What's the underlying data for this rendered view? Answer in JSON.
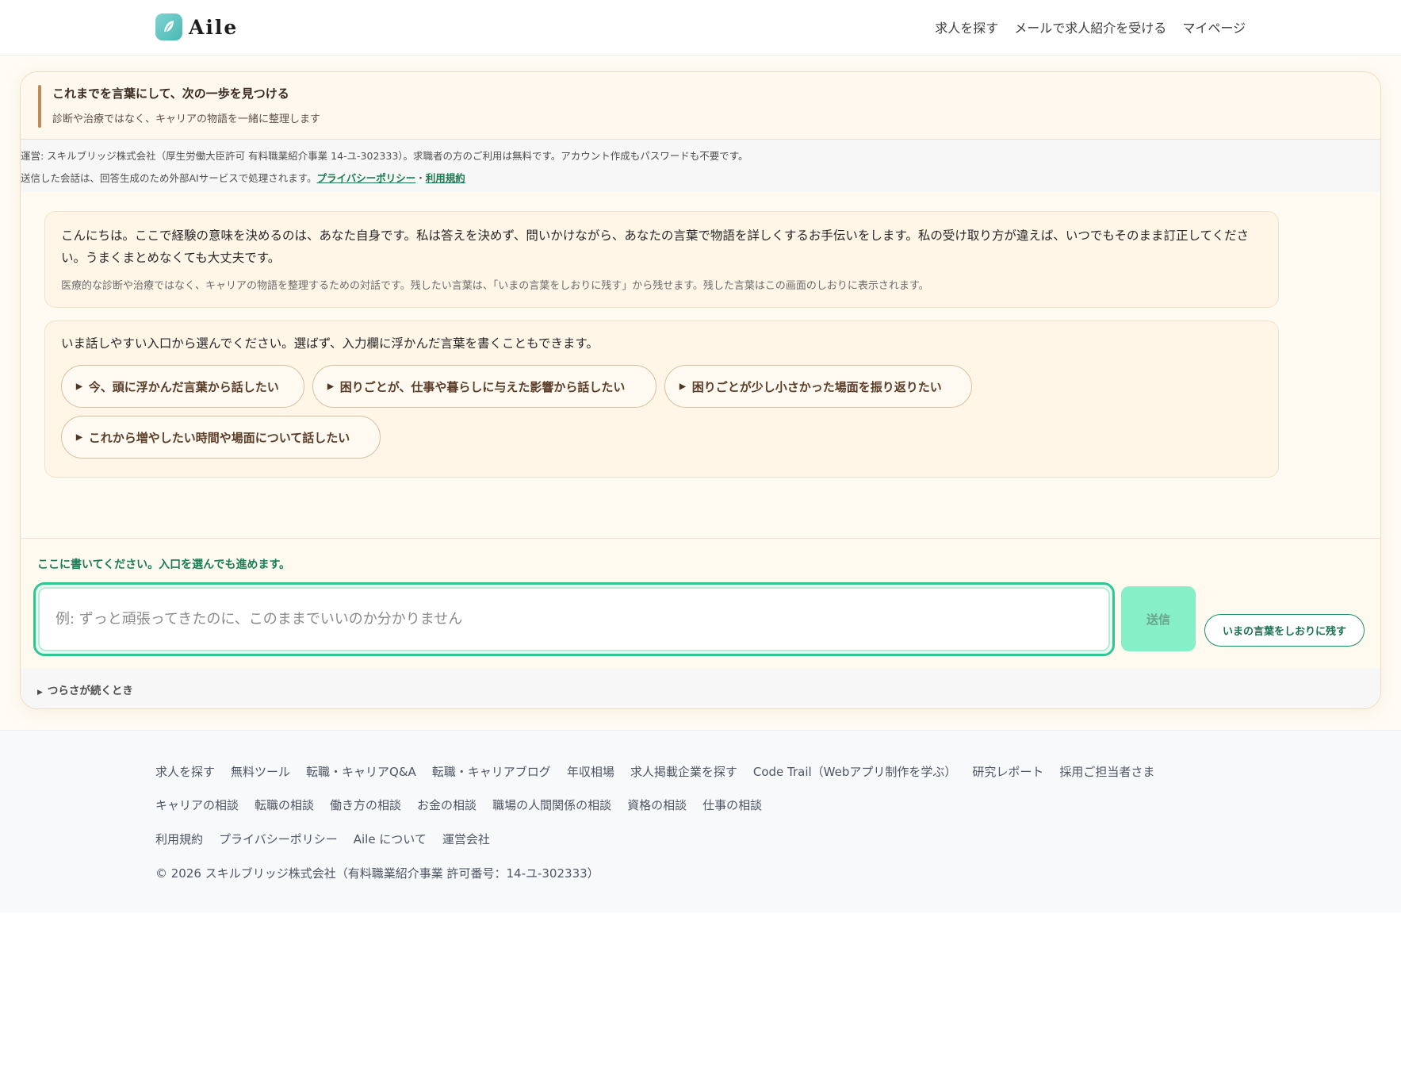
{
  "header": {
    "logo_text": "Aile",
    "nav": [
      "求人を探す",
      "メールで求人紹介を受ける",
      "マイページ"
    ]
  },
  "card": {
    "title": "これまでを言葉にして、次の一歩を見つける",
    "subtitle": "診断や治療ではなく、キャリアの物語を一緒に整理します"
  },
  "notice": {
    "line1": "運営: スキルブリッジ株式会社（厚生労働大臣許可 有料職業紹介事業 14-ユ-302333）。求職者の方のご利用は無料です。アカウント作成もパスワードも不要です。",
    "line2_prefix": "送信した会話は、回答生成のため外部AIサービスで処理されます。",
    "privacy_link": "プライバシーポリシー",
    "separator": "・",
    "terms_link": "利用規約"
  },
  "messages": {
    "greeting": "こんにちは。ここで経験の意味を決めるのは、あなた自身です。私は答えを決めず、問いかけながら、あなたの言葉で物語を詳しくするお手伝いをします。私の受け取り方が違えば、いつでもそのまま訂正してください。うまくまとめなくても大丈夫です。",
    "greeting_note": "医療的な診断や治療ではなく、キャリアの物語を整理するための対話です。残したい言葉は、「いまの言葉をしおりに残す」から残せます。残した言葉はこの画面のしおりに表示されます。",
    "entry_prompt": "いま話しやすい入口から選んでください。選ばず、入力欄に浮かんだ言葉を書くこともできます。"
  },
  "entries": [
    "今、頭に浮かんだ言葉から話したい",
    "困りごとが、仕事や暮らしに与えた影響から話したい",
    "困りごとが少し小さかった場面を振り返りたい",
    "これから増やしたい時間や場面について話したい"
  ],
  "composer": {
    "label": "ここに書いてください。入口を選んでも進めます。",
    "placeholder": "例: ずっと頑張ってきたのに、このままでいいのか分かりません",
    "value": "",
    "send_label": "送信",
    "bookmark_label": "いまの言葉をしおりに残す",
    "tough_label": "つらさが続くとき"
  },
  "footer": {
    "row1": [
      "求人を探す",
      "無料ツール",
      "転職・キャリアQ&A",
      "転職・キャリアブログ",
      "年収相場",
      "求人掲載企業を探す",
      "Code Trail（Webアプリ制作を学ぶ）",
      "研究レポート",
      "採用ご担当者さま"
    ],
    "row2": [
      "キャリアの相談",
      "転職の相談",
      "働き方の相談",
      "お金の相談",
      "職場の人間関係の相談",
      "資格の相談",
      "仕事の相談"
    ],
    "row3": [
      "利用規約",
      "プライバシーポリシー",
      "Aile について",
      "運営会社"
    ],
    "copyright": "© 2026 スキルブリッジ株式会社（有料職業紹介事業 許可番号：14-ユ-302333）"
  },
  "colors": {
    "accent_green": "#2ec793",
    "link_green": "#1b7a52",
    "card_bg": "#fffbf2",
    "accent_brown": "#c2895a"
  },
  "icons": {
    "logo": "feather-icon",
    "entry_marker": "triangle-right-icon"
  }
}
